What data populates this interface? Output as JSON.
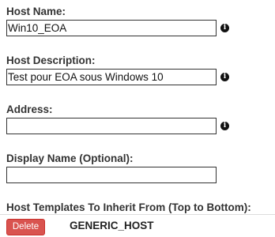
{
  "form": {
    "host_name": {
      "label": "Host Name:",
      "value": "Win10_EOA",
      "info_icon": "info-circle-icon",
      "info_glyph": "i"
    },
    "host_description": {
      "label": "Host Description:",
      "value": "Test pour EOA sous Windows 10",
      "info_icon": "info-circle-icon",
      "info_glyph": "i"
    },
    "address": {
      "label": "Address:",
      "value": "",
      "info_icon": "info-circle-icon",
      "info_glyph": "i"
    },
    "display_name": {
      "label": "Display Name (Optional):",
      "value": ""
    },
    "templates": {
      "label": "Host Templates To Inherit From (Top to Bottom):",
      "items": [
        {
          "delete_label": "Delete",
          "name": "GENERIC_HOST"
        }
      ]
    }
  },
  "colors": {
    "delete_button": "#d9534f",
    "label_text": "#333333"
  }
}
